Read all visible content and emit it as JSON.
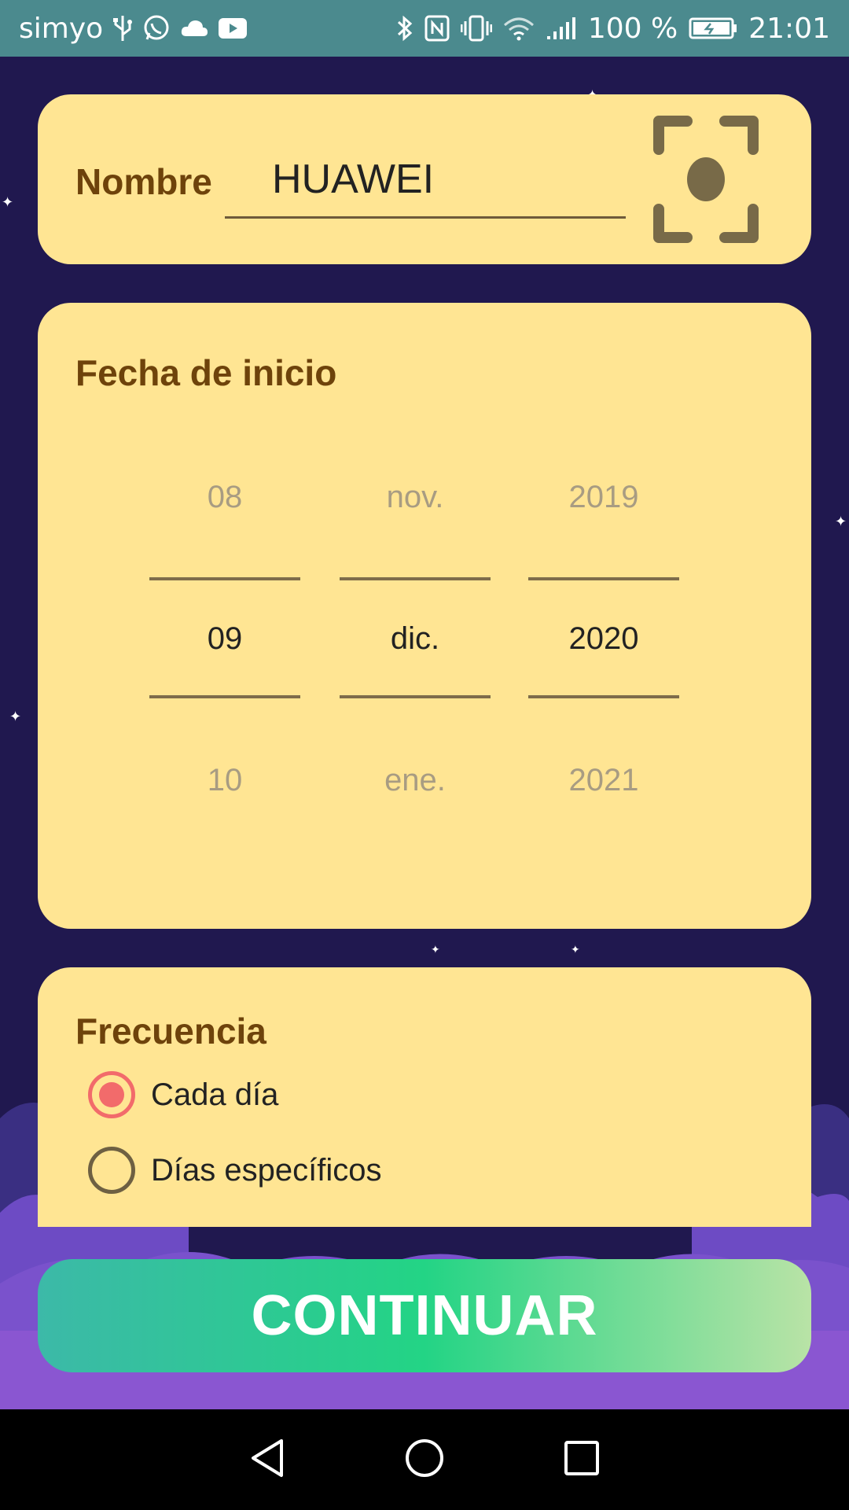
{
  "status_bar": {
    "carrier": "simyo",
    "battery": "100 %",
    "time": "21:01",
    "icons": [
      "usb-icon",
      "whatsapp-icon",
      "cloud-icon",
      "youtube-icon",
      "bluetooth-icon",
      "nfc-icon",
      "vibrate-icon",
      "wifi-icon",
      "signal-icon",
      "battery-icon"
    ]
  },
  "name_card": {
    "label": "Nombre",
    "value": "HUAWEI",
    "scan_icon": "scan-frame-icon"
  },
  "date_card": {
    "label": "Fecha de inicio",
    "day": {
      "prev": "08",
      "selected": "09",
      "next": "10"
    },
    "month": {
      "prev": "nov.",
      "selected": "dic.",
      "next": "ene."
    },
    "year": {
      "prev": "2019",
      "selected": "2020",
      "next": "2021"
    }
  },
  "frequency_card": {
    "label": "Frecuencia",
    "options": [
      {
        "label": "Cada día",
        "selected": true
      },
      {
        "label": "Días específicos",
        "selected": false
      }
    ]
  },
  "continue_button": {
    "label": "CONTINUAR"
  },
  "colors": {
    "background": "#20184f",
    "card": "#ffe593",
    "label": "#6e430b",
    "radio_selected": "#f26b6b",
    "status_bar": "#4b8a8e"
  },
  "nav_bar": {
    "icons": [
      "back-icon",
      "home-icon",
      "recents-icon"
    ]
  }
}
